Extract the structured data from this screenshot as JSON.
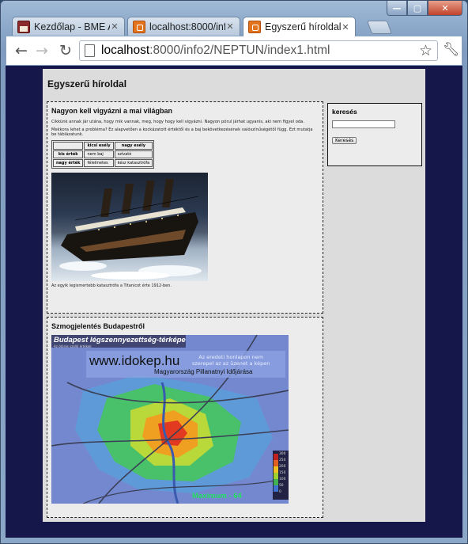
{
  "window": {
    "controls": {
      "minimize": "—",
      "maximize": "▢",
      "close": "✕"
    }
  },
  "tabs": [
    {
      "title": "Kezdőlap - BME A",
      "icon": "calendar-icon",
      "active": false
    },
    {
      "title": "localhost:8000/inf",
      "icon": "page-icon",
      "active": false
    },
    {
      "title": "Egyszerű híroldal -",
      "icon": "page-icon",
      "active": true
    }
  ],
  "toolbar": {
    "url_host": "localhost",
    "url_rest": ":8000/info2/NEPTUN/index1.html"
  },
  "page": {
    "site_title": "Egyszerű híroldal",
    "article1": {
      "title": "Nagyon kell vigyázni a mai világban",
      "p1": "Cikkünk annak jár utána, hogy mik vannak, meg, hogy hogy kell vigyázni. Nagyon pórul járhat ugyanis, aki nem figyel oda.",
      "p2": "Mekkora lehet a probléma? Ez alapvetően a kockázatott értéktől és a baj bekövetkezésének valószínűségétől függ. Ezt mutatja be táblázatunk.",
      "table": {
        "headers": [
          "",
          "kicsi esély",
          "nagy esély"
        ],
        "rows": [
          [
            "kis érték",
            "nem baj",
            "szívató"
          ],
          [
            "nagy érték",
            "félelmetes",
            "kész katasztrófa"
          ]
        ]
      },
      "caption": "Az egyik legismertebb katasztrófa a Titanicot érte 1912-ben."
    },
    "article2": {
      "title": "Szmogjelentés Budapestről",
      "map": {
        "heading": "Budapest légszennyezettség-térképe",
        "subheading": "Az ötórás szálló értékek",
        "brand": "www.idokep.hu",
        "tagline": "Magyarország Pillanatnyi Időjárása",
        "note_line1": "Az eredeti honlapon nem",
        "note_line2": "szerepel az az üzenet a képen",
        "scale": [
          "300",
          "250",
          "200",
          "150",
          "100",
          "50",
          "0"
        ],
        "maximum": "Maximum - 64"
      }
    },
    "sidebar": {
      "title": "keresés",
      "search_value": "",
      "search_button": "Keresés"
    }
  }
}
